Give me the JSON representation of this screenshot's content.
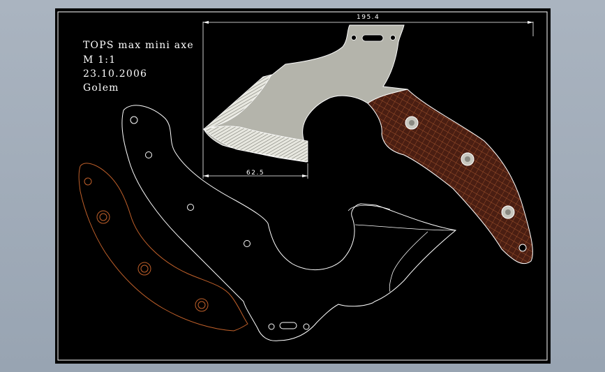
{
  "title_block": {
    "line1": "TOPS max mini axe",
    "line2": "M  1:1",
    "line3": "23.10.2006",
    "line4": "Golem"
  },
  "dimensions": {
    "overall_length": "195.4",
    "edge_length": "62.5"
  },
  "colors": {
    "viewport_bg": "#000000",
    "frame": "#ffffff",
    "line_white": "#ffffff",
    "blade_fill": "#b4b4ab",
    "bevel_hatch": "#808078",
    "handle_scale_fill": "#4a1e12",
    "handle_hatch": "#a0522d",
    "orange_outline": "#c0602a",
    "pin_fill": "#c8c8c0"
  },
  "icons": {
    "pin": "circle-rivet",
    "hatch": "cross-hatch"
  }
}
